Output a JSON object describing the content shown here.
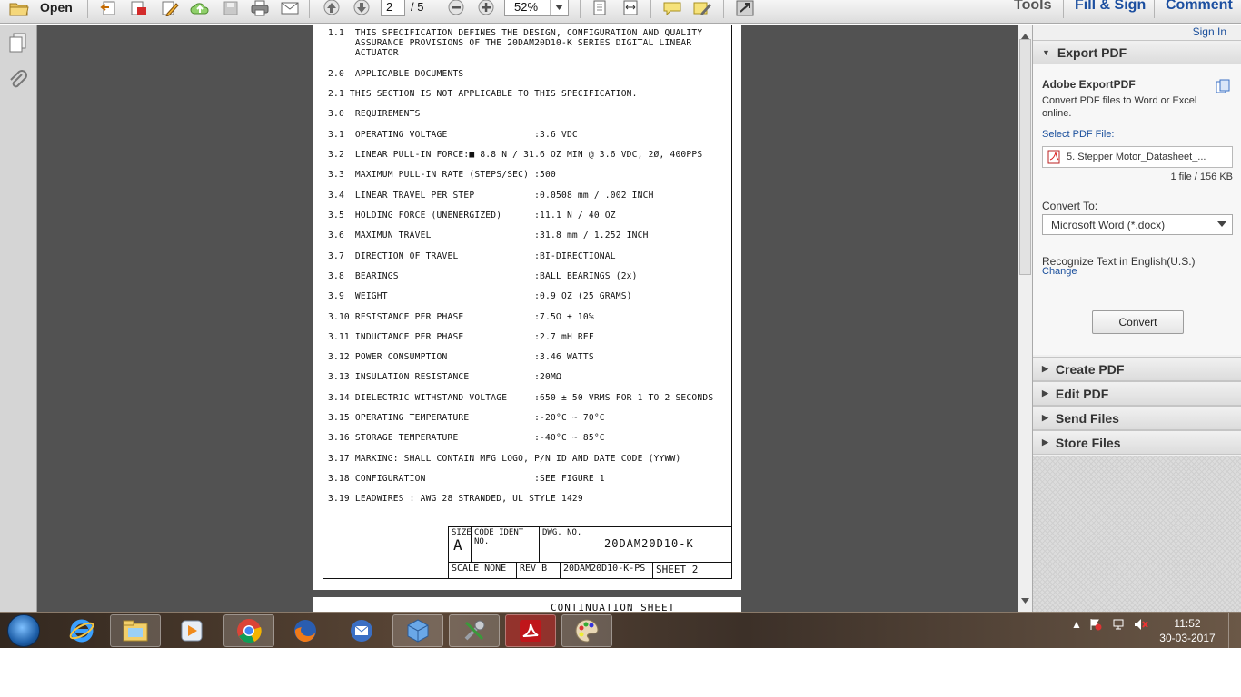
{
  "toolbar": {
    "open_label": "Open",
    "page_current": "2",
    "page_total": "/ 5",
    "zoom": "52%",
    "links": {
      "tools": "Tools",
      "fill_sign": "Fill & Sign",
      "comment": "Comment"
    }
  },
  "document": {
    "lines": [
      "1.1  THIS SPECIFICATION DEFINES THE DESIGN, CONFIGURATION AND QUALITY",
      "     ASSURANCE PROVISIONS OF THE 20DAM20D10-K SERIES DIGITAL LINEAR",
      "     ACTUATOR",
      "2.0  APPLICABLE DOCUMENTS",
      "2.1 THIS SECTION IS NOT APPLICABLE TO THIS SPECIFICATION.",
      "3.0  REQUIREMENTS",
      "3.1  OPERATING VOLTAGE                :3.6 VDC",
      "3.2  LINEAR PULL-IN FORCE:■ 8.8 N / 31.6 OZ MIN @ 3.6 VDC, 2Ø, 400PPS",
      "3.3  MAXIMUM PULL-IN RATE (STEPS/SEC) :500",
      "3.4  LINEAR TRAVEL PER STEP           :0.0508 mm / .002 INCH",
      "3.5  HOLDING FORCE (UNENERGIZED)      :11.1 N / 40 OZ",
      "3.6  MAXIMUN TRAVEL                   :31.8 mm / 1.252 INCH",
      "3.7  DIRECTION OF TRAVEL              :BI-DIRECTIONAL",
      "3.8  BEARINGS                         :BALL BEARINGS (2x)",
      "3.9  WEIGHT                           :0.9 OZ (25 GRAMS)",
      "3.10 RESISTANCE PER PHASE             :7.5Ω ± 10%",
      "3.11 INDUCTANCE PER PHASE             :2.7 mH REF",
      "3.12 POWER CONSUMPTION                :3.46 WATTS",
      "3.13 INSULATION RESISTANCE            :20MΩ",
      "3.14 DIELECTRIC WITHSTAND VOLTAGE     :650 ± 50 VRMS FOR 1 TO 2 SECONDS",
      "3.15 OPERATING TEMPERATURE            :-20°C ~ 70°C",
      "3.16 STORAGE TEMPERATURE              :-40°C ~ 85°C",
      "3.17 MARKING: SHALL CONTAIN MFG LOGO, P/N ID AND DATE CODE (YYWW)",
      "3.18 CONFIGURATION                    :SEE FIGURE 1",
      "3.19 LEADWIRES : AWG 28 STRANDED, UL STYLE 1429"
    ],
    "title_block": {
      "size_label": "SIZE",
      "size_value": "A",
      "code_ident_label": "CODE IDENT NO.",
      "dwg_label": "DWG. NO.",
      "dwg_value": "20DAM20D10-K",
      "scale": "SCALE NONE",
      "rev": "REV B",
      "doc_no": "20DAM20D10-K-PS",
      "sheet": "SHEET  2"
    },
    "next_page_heading": "CONTINUATION SHEET"
  },
  "right_panel": {
    "sign_in": "Sign In",
    "export_header": "Export PDF",
    "service_title": "Adobe ExportPDF",
    "service_desc_1": "Convert PDF files to Word or Excel",
    "service_desc_2": "online.",
    "select_file_label": "Select PDF File:",
    "file_name": "5. Stepper Motor_Datasheet_...",
    "file_info": "1 file / 156 KB",
    "convert_to_label": "Convert To:",
    "convert_to_value": "Microsoft Word (*.docx)",
    "recognize_text": "Recognize Text in English(U.S.)",
    "change_link": "Change",
    "convert_button": "Convert",
    "sections": [
      "Create PDF",
      "Edit PDF",
      "Send Files",
      "Store Files"
    ]
  },
  "taskbar": {
    "time": "11:52",
    "date": "30-03-2017"
  },
  "colors": {
    "link": "#1a4f9c",
    "doc_bg": "#525252",
    "panel_bg": "#f0f0f0"
  }
}
